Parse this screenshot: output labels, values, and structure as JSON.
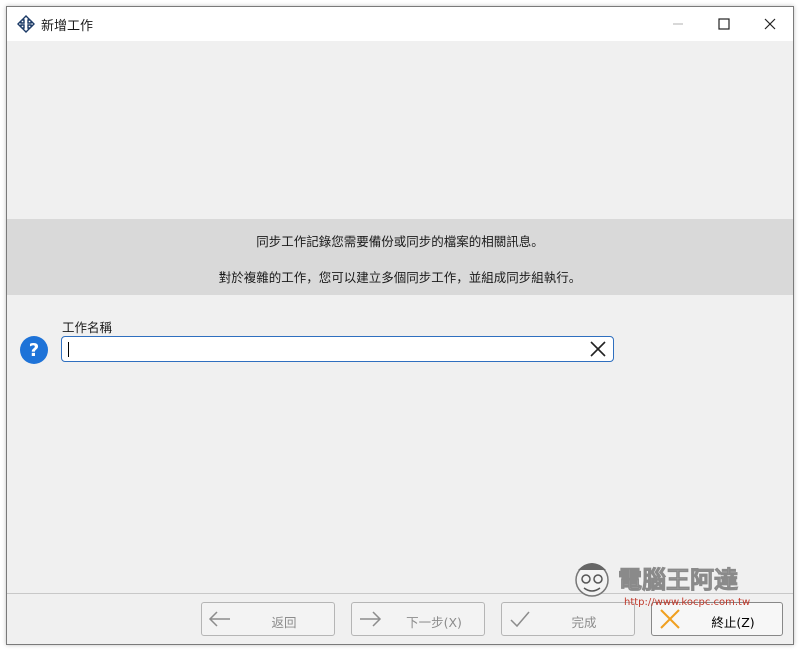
{
  "window": {
    "title": "新增工作"
  },
  "info": {
    "line1": "同步工作記錄您需要備份或同步的檔案的相關訊息。",
    "line2": "對於複雜的工作，您可以建立多個同步工作，並組成同步組執行。"
  },
  "form": {
    "name_label": "工作名稱",
    "name_value": "",
    "help_glyph": "?"
  },
  "footer": {
    "back_label": "返回",
    "next_label": "下一步(X)",
    "finish_label": "完成",
    "stop_label": "終止(Z)"
  },
  "watermark": {
    "name": "電腦王阿達",
    "url": "http://www.kocpc.com.tw"
  },
  "colors": {
    "accent": "#1e73d8",
    "input_border": "#2f6fbf",
    "stop_icon": "#f0a020"
  }
}
